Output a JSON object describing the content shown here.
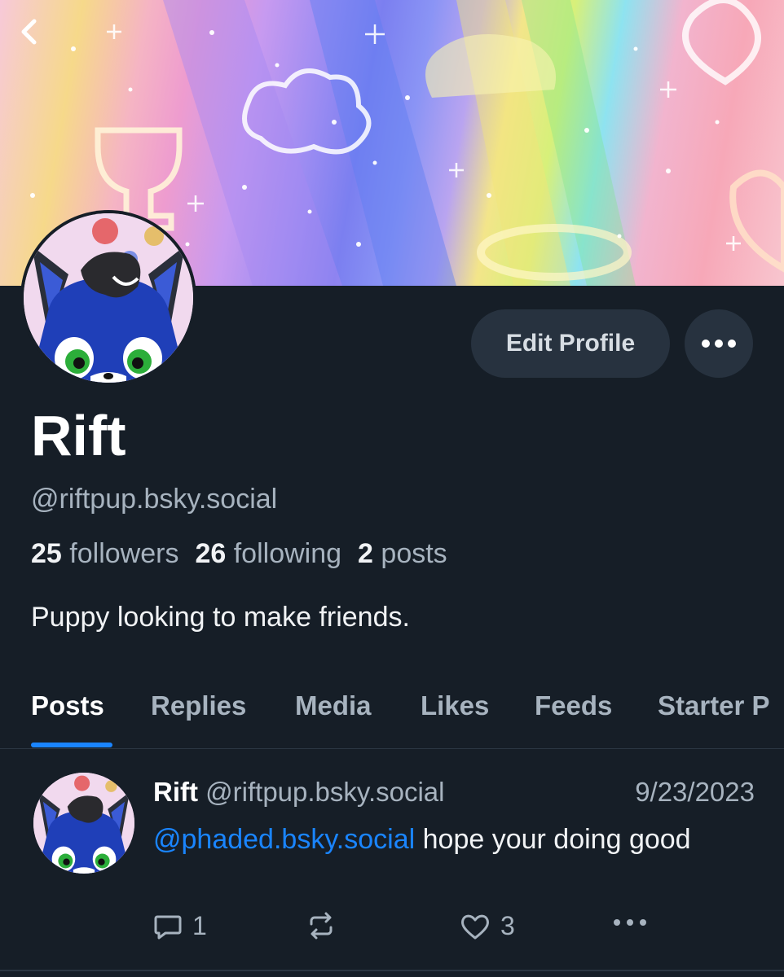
{
  "profile": {
    "display_name": "Rift",
    "handle": "@riftpup.bsky.social",
    "followers_count": "25",
    "followers_label": "followers",
    "following_count": "26",
    "following_label": "following",
    "posts_count": "2",
    "posts_label": "posts",
    "bio": "Puppy looking to make friends.",
    "edit_button": "Edit Profile"
  },
  "tabs": [
    {
      "label": "Posts",
      "active": true
    },
    {
      "label": "Replies",
      "active": false
    },
    {
      "label": "Media",
      "active": false
    },
    {
      "label": "Likes",
      "active": false
    },
    {
      "label": "Feeds",
      "active": false
    },
    {
      "label": "Starter P",
      "active": false
    }
  ],
  "post": {
    "author": "Rift",
    "handle": "@riftpup.bsky.social",
    "date": "9/23/2023",
    "mention": "@phaded.bsky.social",
    "text": " hope your doing good",
    "reply_count": "1",
    "repost_count": "",
    "like_count": "3"
  },
  "icons": {
    "back": "chevron-left-icon",
    "more": "ellipsis-icon",
    "reply": "comment-icon",
    "repost": "repost-icon",
    "like": "heart-icon",
    "post_more": "ellipsis-icon"
  },
  "colors": {
    "background": "#161e27",
    "accent": "#1a85ff",
    "muted_text": "#a7b3bf",
    "button_bg": "#27323f"
  }
}
